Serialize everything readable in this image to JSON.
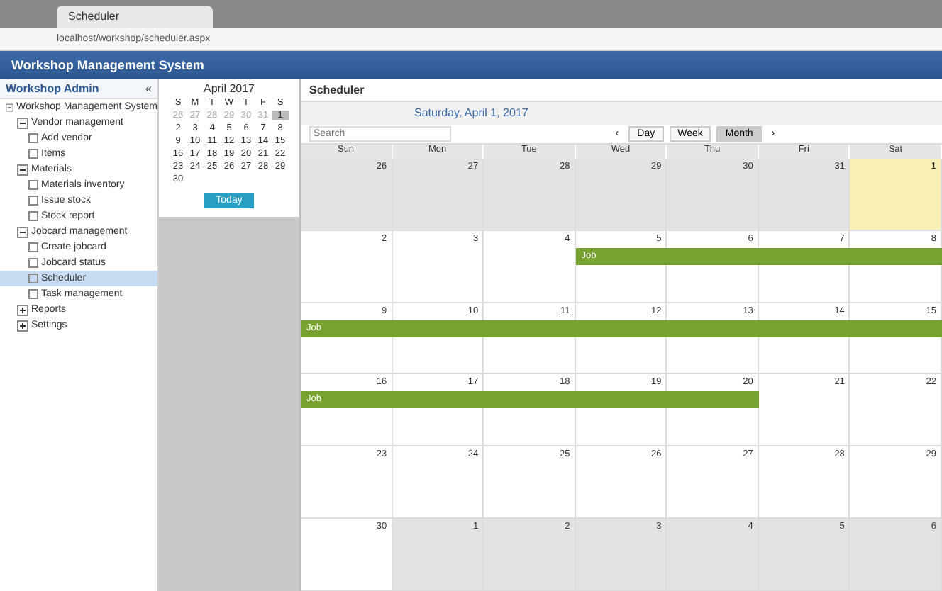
{
  "browser": {
    "tab_title": "Scheduler",
    "address": "localhost/workshop/scheduler.aspx"
  },
  "app": {
    "title": "Workshop Management System"
  },
  "sidebar": {
    "title": "Workshop Admin",
    "collapse": "«",
    "tree": [
      {
        "label": "Workshop Management System",
        "expanded": true,
        "selected": false,
        "children": [
          {
            "label": "Vendor management",
            "expanded": true,
            "selected": false,
            "children": [
              {
                "label": "Add vendor",
                "selected": false
              },
              {
                "label": "Items",
                "selected": false
              }
            ]
          },
          {
            "label": "Materials",
            "expanded": true,
            "selected": false,
            "children": [
              {
                "label": "Materials inventory",
                "selected": false
              },
              {
                "label": "Issue stock",
                "selected": false
              },
              {
                "label": "Stock report",
                "selected": false
              }
            ]
          },
          {
            "label": "Jobcard management",
            "expanded": true,
            "selected": false,
            "children": [
              {
                "label": "Create jobcard",
                "selected": false
              },
              {
                "label": "Jobcard status",
                "selected": false
              },
              {
                "label": "Scheduler",
                "selected": true
              },
              {
                "label": "Task management",
                "selected": false
              }
            ]
          },
          {
            "label": "Reports",
            "expanded": false,
            "selected": false
          },
          {
            "label": "Settings",
            "expanded": false,
            "selected": false
          }
        ]
      }
    ]
  },
  "mini_calendar": {
    "title": "April 2017",
    "weekdays": [
      "S",
      "M",
      "T",
      "W",
      "T",
      "F",
      "S"
    ],
    "weeks": [
      [
        {
          "d": "26",
          "muted": true,
          "selected": false
        },
        {
          "d": "27",
          "muted": true,
          "selected": false
        },
        {
          "d": "28",
          "muted": true,
          "selected": false
        },
        {
          "d": "29",
          "muted": true,
          "selected": false
        },
        {
          "d": "30",
          "muted": true,
          "selected": false
        },
        {
          "d": "31",
          "muted": true,
          "selected": false
        },
        {
          "d": "1",
          "muted": false,
          "selected": true
        }
      ],
      [
        {
          "d": "2",
          "muted": false,
          "selected": false
        },
        {
          "d": "3",
          "muted": false,
          "selected": false
        },
        {
          "d": "4",
          "muted": false,
          "selected": false
        },
        {
          "d": "5",
          "muted": false,
          "selected": false
        },
        {
          "d": "6",
          "muted": false,
          "selected": false
        },
        {
          "d": "7",
          "muted": false,
          "selected": false
        },
        {
          "d": "8",
          "muted": false,
          "selected": false
        }
      ],
      [
        {
          "d": "9",
          "muted": false,
          "selected": false
        },
        {
          "d": "10",
          "muted": false,
          "selected": false
        },
        {
          "d": "11",
          "muted": false,
          "selected": false
        },
        {
          "d": "12",
          "muted": false,
          "selected": false
        },
        {
          "d": "13",
          "muted": false,
          "selected": false
        },
        {
          "d": "14",
          "muted": false,
          "selected": false
        },
        {
          "d": "15",
          "muted": false,
          "selected": false
        }
      ],
      [
        {
          "d": "16",
          "muted": false,
          "selected": false
        },
        {
          "d": "17",
          "muted": false,
          "selected": false
        },
        {
          "d": "18",
          "muted": false,
          "selected": false
        },
        {
          "d": "19",
          "muted": false,
          "selected": false
        },
        {
          "d": "20",
          "muted": false,
          "selected": false
        },
        {
          "d": "21",
          "muted": false,
          "selected": false
        },
        {
          "d": "22",
          "muted": false,
          "selected": false
        }
      ],
      [
        {
          "d": "23",
          "muted": false,
          "selected": false
        },
        {
          "d": "24",
          "muted": false,
          "selected": false
        },
        {
          "d": "25",
          "muted": false,
          "selected": false
        },
        {
          "d": "26",
          "muted": false,
          "selected": false
        },
        {
          "d": "27",
          "muted": false,
          "selected": false
        },
        {
          "d": "28",
          "muted": false,
          "selected": false
        },
        {
          "d": "29",
          "muted": false,
          "selected": false
        }
      ],
      [
        {
          "d": "30",
          "muted": false,
          "selected": false
        }
      ]
    ],
    "today_button": "Today"
  },
  "scheduler": {
    "title": "Scheduler",
    "date": "Saturday, April 1, 2017",
    "search_placeholder": "Search",
    "views": [
      {
        "label": "Day",
        "selected": false
      },
      {
        "label": "Week",
        "selected": false
      },
      {
        "label": "Month",
        "selected": true
      }
    ],
    "weekdays": [
      "Sun",
      "Mon",
      "Tue",
      "Wed",
      "Thu",
      "Fri",
      "Sat"
    ],
    "weeks": [
      [
        {
          "d": "26",
          "muted": true,
          "today": false
        },
        {
          "d": "27",
          "muted": true,
          "today": false
        },
        {
          "d": "28",
          "muted": true,
          "today": false
        },
        {
          "d": "29",
          "muted": true,
          "today": false
        },
        {
          "d": "30",
          "muted": true,
          "today": false
        },
        {
          "d": "31",
          "muted": true,
          "today": false
        },
        {
          "d": "1",
          "muted": false,
          "today": true
        }
      ],
      [
        {
          "d": "2",
          "muted": false,
          "today": false
        },
        {
          "d": "3",
          "muted": false,
          "today": false
        },
        {
          "d": "4",
          "muted": false,
          "today": false
        },
        {
          "d": "5",
          "muted": false,
          "today": false
        },
        {
          "d": "6",
          "muted": false,
          "today": false
        },
        {
          "d": "7",
          "muted": false,
          "today": false
        },
        {
          "d": "8",
          "muted": false,
          "today": false
        }
      ],
      [
        {
          "d": "9",
          "muted": false,
          "today": false
        },
        {
          "d": "10",
          "muted": false,
          "today": false
        },
        {
          "d": "11",
          "muted": false,
          "today": false
        },
        {
          "d": "12",
          "muted": false,
          "today": false
        },
        {
          "d": "13",
          "muted": false,
          "today": false
        },
        {
          "d": "14",
          "muted": false,
          "today": false
        },
        {
          "d": "15",
          "muted": false,
          "today": false
        }
      ],
      [
        {
          "d": "16",
          "muted": false,
          "today": false
        },
        {
          "d": "17",
          "muted": false,
          "today": false
        },
        {
          "d": "18",
          "muted": false,
          "today": false
        },
        {
          "d": "19",
          "muted": false,
          "today": false
        },
        {
          "d": "20",
          "muted": false,
          "today": false
        },
        {
          "d": "21",
          "muted": false,
          "today": false
        },
        {
          "d": "22",
          "muted": false,
          "today": false
        }
      ],
      [
        {
          "d": "23",
          "muted": false,
          "today": false
        },
        {
          "d": "24",
          "muted": false,
          "today": false
        },
        {
          "d": "25",
          "muted": false,
          "today": false
        },
        {
          "d": "26",
          "muted": false,
          "today": false
        },
        {
          "d": "27",
          "muted": false,
          "today": false
        },
        {
          "d": "28",
          "muted": false,
          "today": false
        },
        {
          "d": "29",
          "muted": false,
          "today": false
        }
      ],
      [
        {
          "d": "30",
          "muted": false,
          "today": false
        },
        {
          "d": "1",
          "muted": true,
          "today": false
        },
        {
          "d": "2",
          "muted": true,
          "today": false
        },
        {
          "d": "3",
          "muted": true,
          "today": false
        },
        {
          "d": "4",
          "muted": true,
          "today": false
        },
        {
          "d": "5",
          "muted": true,
          "today": false
        },
        {
          "d": "6",
          "muted": true,
          "today": false
        }
      ]
    ],
    "prev": "‹",
    "next": "›",
    "events": [
      {
        "label": "Job"
      },
      {
        "label": "Job"
      },
      {
        "label": "Job"
      }
    ]
  }
}
